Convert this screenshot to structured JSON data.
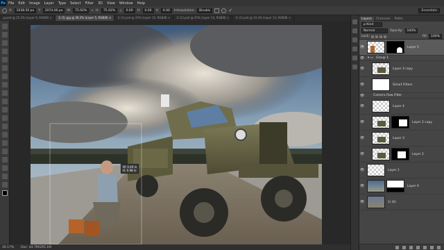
{
  "app": {
    "logo": "Ps"
  },
  "menu": [
    "File",
    "Edit",
    "Image",
    "Layer",
    "Type",
    "Select",
    "Filter",
    "3D",
    "View",
    "Window",
    "Help"
  ],
  "options": {
    "x_label": "X:",
    "x_value": "1038.50 px",
    "y_label": "Y:",
    "y_value": "2074.00 px",
    "w_label": "W:",
    "w_value": "75.92%",
    "h_label": "H:",
    "h_value": "75.92%",
    "angle_label": "△",
    "angle_value": "0.00",
    "h_skew_label": "H:",
    "h_skew_value": "0.00",
    "v_skew_label": "V:",
    "v_skew_value": "0.00",
    "interp_label": "Interpolation:",
    "interp_value": "Bicubic",
    "workspace": "Essentials"
  },
  "tabs": [
    {
      "label": "yy.psd @ 25.2% (Layer 0, RGB/8) ×",
      "active": false
    },
    {
      "label": "1i (1).jpg @ 26.2% (Layer 5, RGB/8) ×",
      "active": true
    },
    {
      "label": "1i (2).psd @ 25% (Layer 13, RGB/8) ×",
      "active": false
    },
    {
      "label": "1i (2).psd @ 25% (Layer 13, RGB/8) ×",
      "active": false
    },
    {
      "label": "1i (2).psd @ 33.3% (Layer 13, RGB/8) ×",
      "active": false
    }
  ],
  "status": {
    "zoom": "26.17%",
    "doc": "Doc: 44.7M/295.1M"
  },
  "canvas_readout": {
    "w": "W: 0.49 in",
    "h": "H: 0.98 in"
  },
  "panel": {
    "tabs": [
      "Layers",
      "Channels",
      "Paths"
    ],
    "kind_label": "ρ Kind",
    "blend_mode": "Normal",
    "opacity_label": "Opacity:",
    "opacity_value": "100%",
    "lock_label": "Lock:",
    "fill_label": "Fill:",
    "fill_value": "100%",
    "layers": [
      {
        "name": "Layer 5",
        "selected": true,
        "type": "layer"
      },
      {
        "name": "Group 1",
        "type": "group"
      },
      {
        "name": "Layer 3 copy",
        "type": "layer"
      },
      {
        "name": "Smart Filters",
        "type": "layer"
      },
      {
        "name": "Camera Raw Filter",
        "type": "small"
      },
      {
        "name": "Layer 4",
        "type": "layer"
      },
      {
        "name": "Layer 2 copy",
        "type": "layer"
      },
      {
        "name": "Layer 3",
        "type": "layer"
      },
      {
        "name": "Layer 2",
        "type": "layer"
      },
      {
        "name": "Layer 1",
        "type": "layer"
      },
      {
        "name": "Layer 0",
        "type": "layer"
      },
      {
        "name": "1i (6)",
        "type": "layer"
      }
    ]
  },
  "colors": {
    "accent": "#31a8ff",
    "panel_bg": "#454545",
    "app_bg": "#282828"
  }
}
